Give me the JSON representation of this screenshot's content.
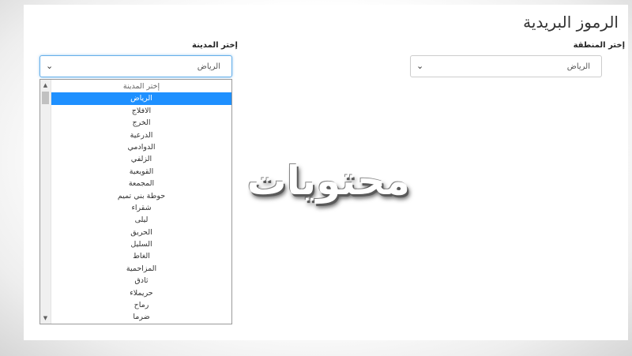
{
  "page": {
    "title": "الرموز البريدية"
  },
  "region_select": {
    "label": "إختر المنطقة",
    "value": "الرياض"
  },
  "city_select": {
    "label": "إختر المدينة",
    "value": "الرياض",
    "expanded": true,
    "options": [
      "إختر المدينة",
      "الرياض",
      "الافلاج",
      "الخرج",
      "الدرعية",
      "الدوادمي",
      "الزلفي",
      "القويعية",
      "المجمعة",
      "حوطة بني تميم",
      "شقراء",
      "ليلى",
      "الحريق",
      "السليل",
      "الغاط",
      "المزاحمية",
      "ثادق",
      "حريملاء",
      "رماح",
      "ضرما"
    ],
    "selected_index": 1
  },
  "watermark": "محتويات",
  "icons": {
    "select_arrow": "chevron-down-icon",
    "scroll_up": "scroll-up-icon",
    "scroll_down": "scroll-down-icon"
  }
}
